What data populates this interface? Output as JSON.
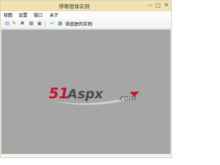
{
  "window": {
    "title": "停靠窗体实例",
    "controls": {
      "minimize": "—",
      "maximize": "□",
      "close": "✕"
    }
  },
  "menu": {
    "items": [
      "视图",
      "设置",
      "窗口",
      "关于"
    ]
  },
  "toolbar": {
    "buttons": [
      {
        "name": "open-icon",
        "glyph": "▤",
        "color": "#6d7fa8"
      },
      {
        "name": "edit-icon",
        "glyph": "✎",
        "color": "#a05a2c"
      },
      {
        "name": "tools-icon",
        "glyph": "✖",
        "color": "#555555"
      },
      {
        "name": "list-icon",
        "glyph": "▦",
        "color": "#4c6aa8"
      },
      {
        "name": "document-icon",
        "glyph": "▣",
        "color": "#666666"
      },
      {
        "name": "export-icon",
        "glyph": "⇨",
        "color": "#2e8b57"
      },
      {
        "name": "grid-icon",
        "glyph": "▦",
        "color": "#3b7a3b"
      }
    ],
    "label": "带皮肤的实例"
  },
  "logo": {
    "numerals": "51",
    "brand": "Aspx",
    "domain": ".com",
    "colors": {
      "red": "#c8102e",
      "grey": "#4a4a4a"
    }
  }
}
